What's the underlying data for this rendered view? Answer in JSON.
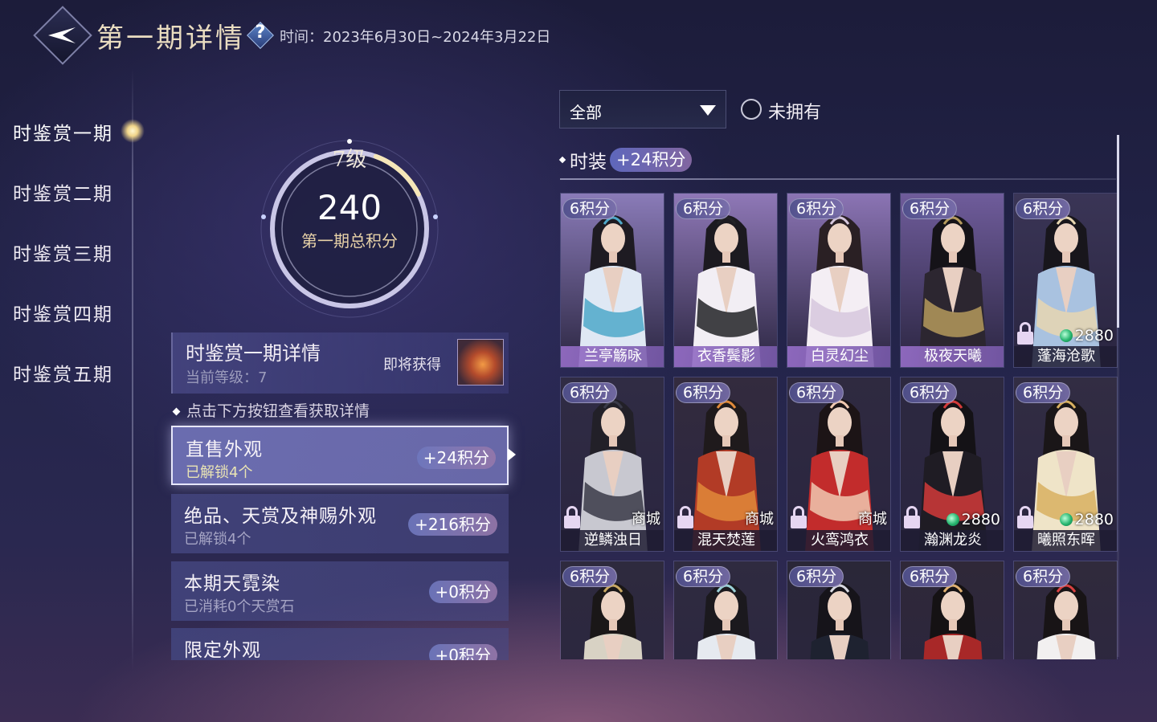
{
  "header": {
    "title": "第一期详情",
    "help_icon": "question-icon",
    "time_label": "时间：",
    "time_value": "2023年6月30日~2024年3月22日"
  },
  "nav": {
    "items": [
      {
        "label": "时鉴赏一期",
        "active": true
      },
      {
        "label": "时鉴赏二期",
        "active": false
      },
      {
        "label": "时鉴赏三期",
        "active": false
      },
      {
        "label": "时鉴赏四期",
        "active": false
      },
      {
        "label": "时鉴赏五期",
        "active": false
      }
    ]
  },
  "score": {
    "level": "7级",
    "value": "240",
    "label": "第一期总积分",
    "ring_progress": 0.12
  },
  "detail": {
    "title": "时鉴赏一期详情",
    "level_text": "当前等级：7",
    "upcoming": "即将获得"
  },
  "hint": "点击下方按钮查看获取详情",
  "categories": [
    {
      "title": "直售外观",
      "sub": "已解锁4个",
      "pts": "+24积分",
      "selected": true
    },
    {
      "title": "绝品、天赏及神赐外观",
      "sub": "已解锁4个",
      "pts": "+216积分",
      "selected": false
    },
    {
      "title": "本期天霓染",
      "sub": "已消耗0个天赏石",
      "pts": "+0积分",
      "selected": false
    },
    {
      "title": "限定外观",
      "sub": "",
      "pts": "+0积分",
      "selected": false
    }
  ],
  "filter": {
    "value": "全部",
    "unowned_label": "未拥有"
  },
  "section": {
    "label": "时装",
    "pts": "+24积分"
  },
  "costumes": [
    {
      "pts": "6积分",
      "name": "兰亭觞咏",
      "locked": false,
      "source": "",
      "price": "",
      "bg": "#8a7bb8",
      "robe": "#dfe8f4",
      "accent": "#4fa8c9",
      "hair": "#1e1b22"
    },
    {
      "pts": "6积分",
      "name": "衣香鬓影",
      "locked": false,
      "source": "",
      "price": "",
      "bg": "#8f78b7",
      "robe": "#f2eef4",
      "accent": "#222226",
      "hair": "#1c1a20"
    },
    {
      "pts": "6积分",
      "name": "白灵幻尘",
      "locked": false,
      "source": "",
      "price": "",
      "bg": "#8b74b4",
      "robe": "#f4eef4",
      "accent": "#d6c7dd",
      "hair": "#2a2024"
    },
    {
      "pts": "6积分",
      "name": "极夜天曦",
      "locked": false,
      "source": "",
      "price": "",
      "bg": "#6f5c9b",
      "robe": "#2c2630",
      "accent": "#b59a5c",
      "hair": "#151318"
    },
    {
      "pts": "6积分",
      "name": "蓬海沧歌",
      "locked": true,
      "source": "",
      "price": "2880",
      "bg": "#3a3556",
      "robe": "#a9c2e0",
      "accent": "#e7d6b0",
      "hair": "#18161c"
    },
    {
      "pts": "6积分",
      "name": "逆鳞浊日",
      "locked": true,
      "source": "商城",
      "price": "",
      "bg": "#302c44",
      "robe": "#c8c8d0",
      "accent": "#3a3a48",
      "hair": "#222028"
    },
    {
      "pts": "6积分",
      "name": "混天焚莲",
      "locked": true,
      "source": "商城",
      "price": "",
      "bg": "#332b3e",
      "robe": "#b23b26",
      "accent": "#e08a3a",
      "hair": "#1f1a1c"
    },
    {
      "pts": "6积分",
      "name": "火鸾鸿衣",
      "locked": true,
      "source": "商城",
      "price": "",
      "bg": "#2f2a40",
      "robe": "#c22c2c",
      "accent": "#f0c8b0",
      "hair": "#1c1416"
    },
    {
      "pts": "6积分",
      "name": "瀚渊龙炎",
      "locked": true,
      "source": "",
      "price": "2880",
      "bg": "#2d2940",
      "robe": "#1f1c24",
      "accent": "#d23a3a",
      "hair": "#141216"
    },
    {
      "pts": "6积分",
      "name": "曦照东晖",
      "locked": true,
      "source": "",
      "price": "2880",
      "bg": "#322d43",
      "robe": "#efe4c8",
      "accent": "#d8b060",
      "hair": "#1a1618"
    },
    {
      "pts": "6积分",
      "name": "",
      "locked": false,
      "source": "",
      "price": "",
      "bg": "#2e2a3e",
      "robe": "#d8d2c4",
      "accent": "#c9a862",
      "hair": "#1a1718"
    },
    {
      "pts": "6积分",
      "name": "",
      "locked": false,
      "source": "",
      "price": "",
      "bg": "#2f2b40",
      "robe": "#e6eaf0",
      "accent": "#9ad0d6",
      "hair": "#1b191e"
    },
    {
      "pts": "6积分",
      "name": "",
      "locked": false,
      "source": "",
      "price": "",
      "bg": "#2a2738",
      "robe": "#1e2230",
      "accent": "#d8d8e0",
      "hair": "#16141a"
    },
    {
      "pts": "6积分",
      "name": "",
      "locked": false,
      "source": "",
      "price": "",
      "bg": "#2f2838",
      "robe": "#a82828",
      "accent": "#e0b070",
      "hair": "#151214"
    },
    {
      "pts": "6积分",
      "name": "",
      "locked": false,
      "source": "",
      "price": "",
      "bg": "#302a3c",
      "robe": "#f2f0f0",
      "accent": "#d84040",
      "hair": "#181416"
    }
  ]
}
